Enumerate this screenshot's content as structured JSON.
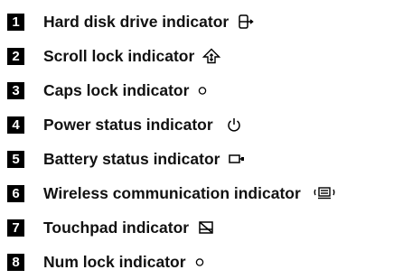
{
  "indicators": [
    {
      "number": "1",
      "label": "Hard disk drive indicator",
      "icon": "hard-disk-icon"
    },
    {
      "number": "2",
      "label": "Scroll lock indicator",
      "icon": "scroll-lock-icon"
    },
    {
      "number": "3",
      "label": "Caps lock indicator",
      "icon": "circle-indicator-icon"
    },
    {
      "number": "4",
      "label": "Power status indicator",
      "icon": "power-icon"
    },
    {
      "number": "5",
      "label": "Battery status indicator",
      "icon": "battery-icon"
    },
    {
      "number": "6",
      "label": "Wireless communication indicator",
      "icon": "wireless-icon"
    },
    {
      "number": "7",
      "label": "Touchpad indicator",
      "icon": "touchpad-icon"
    },
    {
      "number": "8",
      "label": "Num lock indicator",
      "icon": "circle-indicator-icon"
    }
  ]
}
